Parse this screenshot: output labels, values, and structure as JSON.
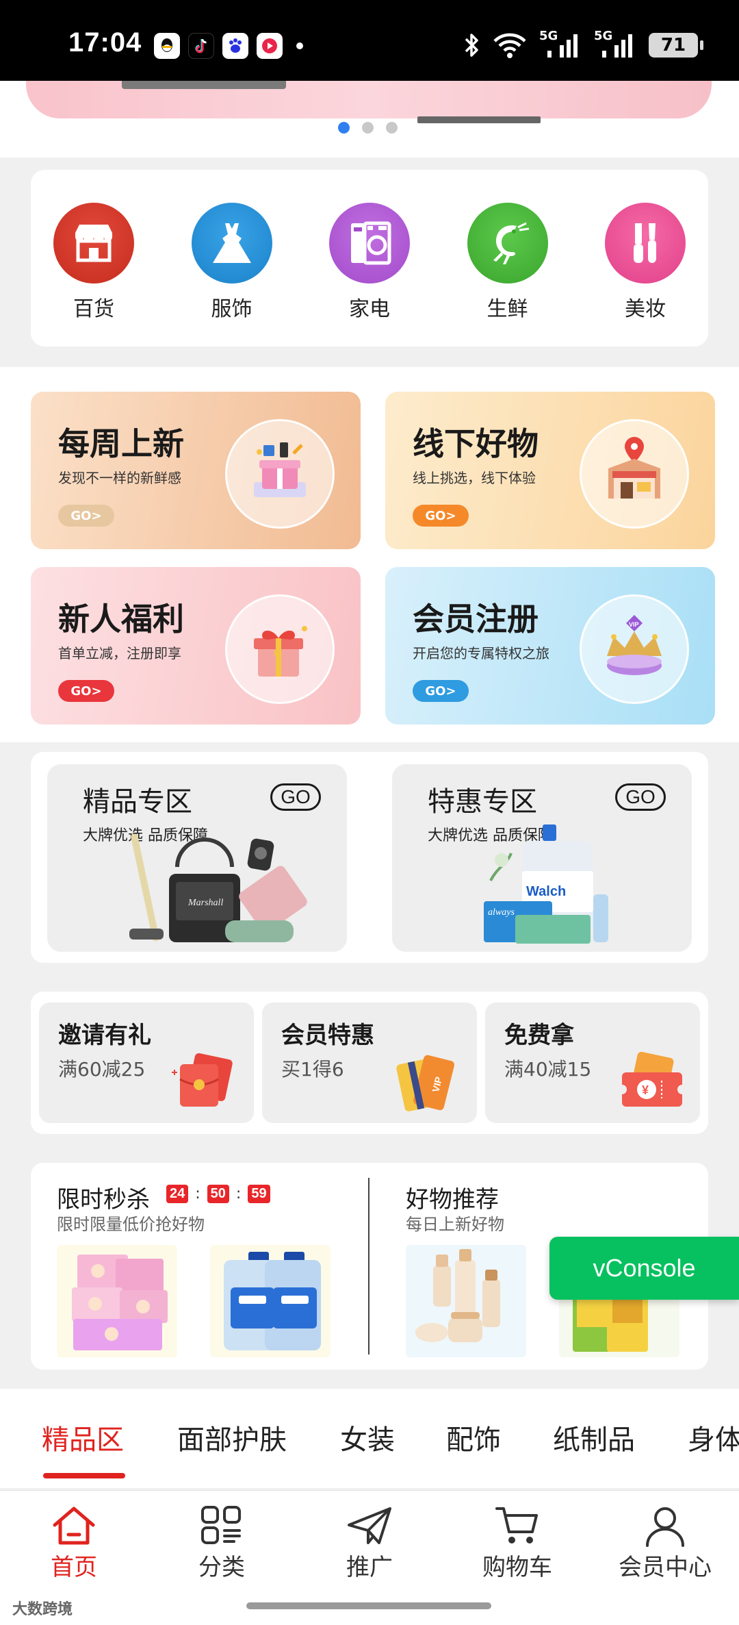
{
  "status_bar": {
    "time": "17:04",
    "network_1": "5G",
    "network_2": "5G",
    "battery": "71"
  },
  "categories": [
    {
      "label": "百货",
      "icon": "store-icon",
      "color": "#d6392a"
    },
    {
      "label": "服饰",
      "icon": "dress-icon",
      "color": "#1f8fd6"
    },
    {
      "label": "家电",
      "icon": "washing-machine-icon",
      "color": "#b45ad6"
    },
    {
      "label": "生鲜",
      "icon": "shrimp-icon",
      "color": "#4bb93a"
    },
    {
      "label": "美妆",
      "icon": "makeup-brush-icon",
      "color": "#ee4f95"
    }
  ],
  "promos": [
    {
      "title": "每周上新",
      "subtitle": "发现不一样的新鲜感",
      "go": "GO>"
    },
    {
      "title": "线下好物",
      "subtitle": "线上挑选，线下体验",
      "go": "GO>"
    },
    {
      "title": "新人福利",
      "subtitle": "首单立减，注册即享",
      "go": "GO>"
    },
    {
      "title": "会员注册",
      "subtitle": "开启您的专属特权之旅",
      "go": "GO>"
    }
  ],
  "zones": [
    {
      "title": "精品专区",
      "subtitle": "大牌优选 品质保障",
      "go": "GO"
    },
    {
      "title": "特惠专区",
      "subtitle": "大牌优选 品质保障",
      "go": "GO"
    }
  ],
  "small_promos": [
    {
      "title": "邀请有礼",
      "subtitle": "满60减25"
    },
    {
      "title": "会员特惠",
      "subtitle": "买1得6"
    },
    {
      "title": "免费拿",
      "subtitle": "满40减15"
    }
  ],
  "flash_sale": {
    "title": "限时秒杀",
    "subtitle": "限时限量低价抢好物",
    "hours": "24",
    "minutes": "50",
    "seconds": "59"
  },
  "recommend": {
    "title": "好物推荐",
    "subtitle": "每日上新好物"
  },
  "vconsole": "vConsole",
  "tabs": [
    "精品区",
    "面部护肤",
    "女装",
    "配饰",
    "纸制品",
    "身体"
  ],
  "bottom_nav": [
    {
      "label": "首页",
      "icon": "home-icon"
    },
    {
      "label": "分类",
      "icon": "category-grid-icon"
    },
    {
      "label": "推广",
      "icon": "paper-plane-icon"
    },
    {
      "label": "购物车",
      "icon": "cart-icon"
    },
    {
      "label": "会员中心",
      "icon": "user-icon"
    }
  ],
  "watermark": "大数跨境",
  "colors": {
    "accent": "#e0231f",
    "vconsole": "#07c160",
    "dot_active": "#2f7ff0"
  }
}
